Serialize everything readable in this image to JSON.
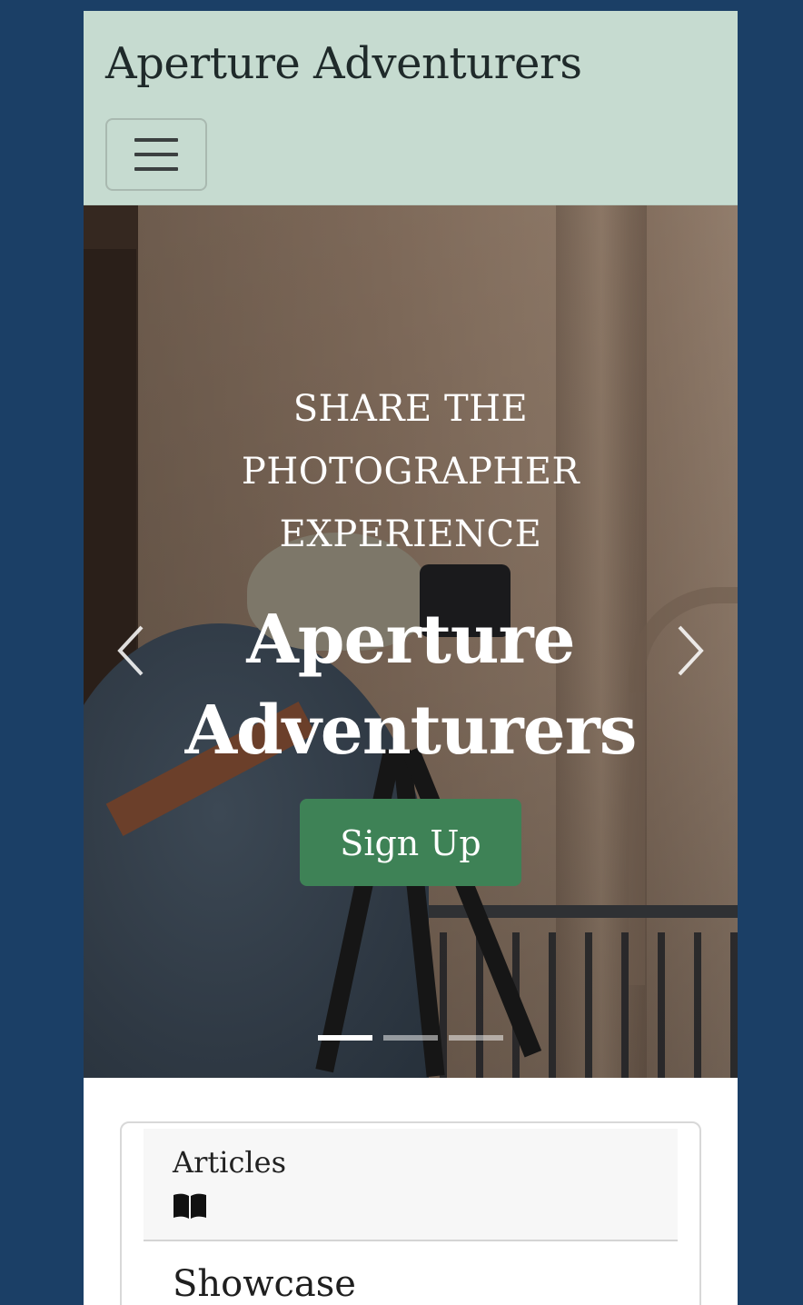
{
  "navbar": {
    "brand": "Aperture Adventurers",
    "toggler_icon": "hamburger-menu-icon"
  },
  "hero": {
    "tagline": "SHARE THE PHOTOGRAPHER EXPERIENCE",
    "title": "Aperture Adventurers",
    "signup_label": "Sign Up",
    "prev_icon": "chevron-left-icon",
    "next_icon": "chevron-right-icon",
    "slides_count": 3,
    "active_slide": 1,
    "button_color": "#3e8256"
  },
  "card": {
    "header_label": "Articles",
    "header_icon": "book-open-icon",
    "next_item": "Showcase"
  },
  "colors": {
    "page_background": "#1b3f66",
    "navbar_background": "#c6dbd0"
  }
}
